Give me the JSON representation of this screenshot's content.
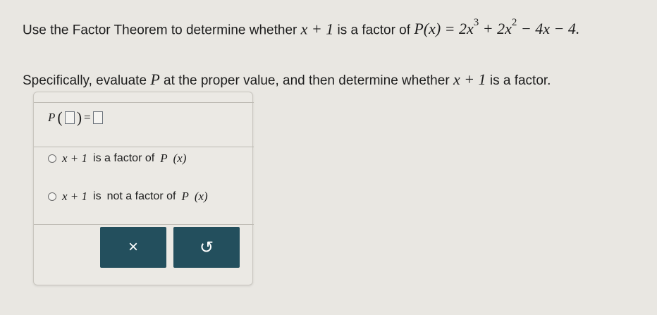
{
  "question": {
    "line1_prefix": "Use the Factor Theorem to determine whether",
    "factor_expr": "x + 1",
    "line1_mid": "is a factor of",
    "polynomial_lhs": "P(x) = 2x",
    "exp3": "3",
    "poly_mid": "+ 2x",
    "exp2": "2",
    "poly_tail": "− 4x − 4.",
    "line2_prefix": "Specifically, evaluate",
    "line2_var": "P",
    "line2_mid": "at the proper value, and then determine whether",
    "line2_factor": "x + 1",
    "line2_suffix": "is a factor."
  },
  "answer_box": {
    "p_symbol": "P",
    "equals": "=",
    "input_value": "",
    "result_value": ""
  },
  "options": [
    {
      "expr": "x + 1",
      "label_a": "is a factor of",
      "label_b": "",
      "func": "P",
      "arg": "(x)"
    },
    {
      "expr": "x + 1",
      "label_a": "is",
      "label_b": "not a factor of",
      "func": "P",
      "arg": "(x)"
    }
  ],
  "buttons": {
    "clear_symbol": "×",
    "undo_symbol": "↺"
  }
}
